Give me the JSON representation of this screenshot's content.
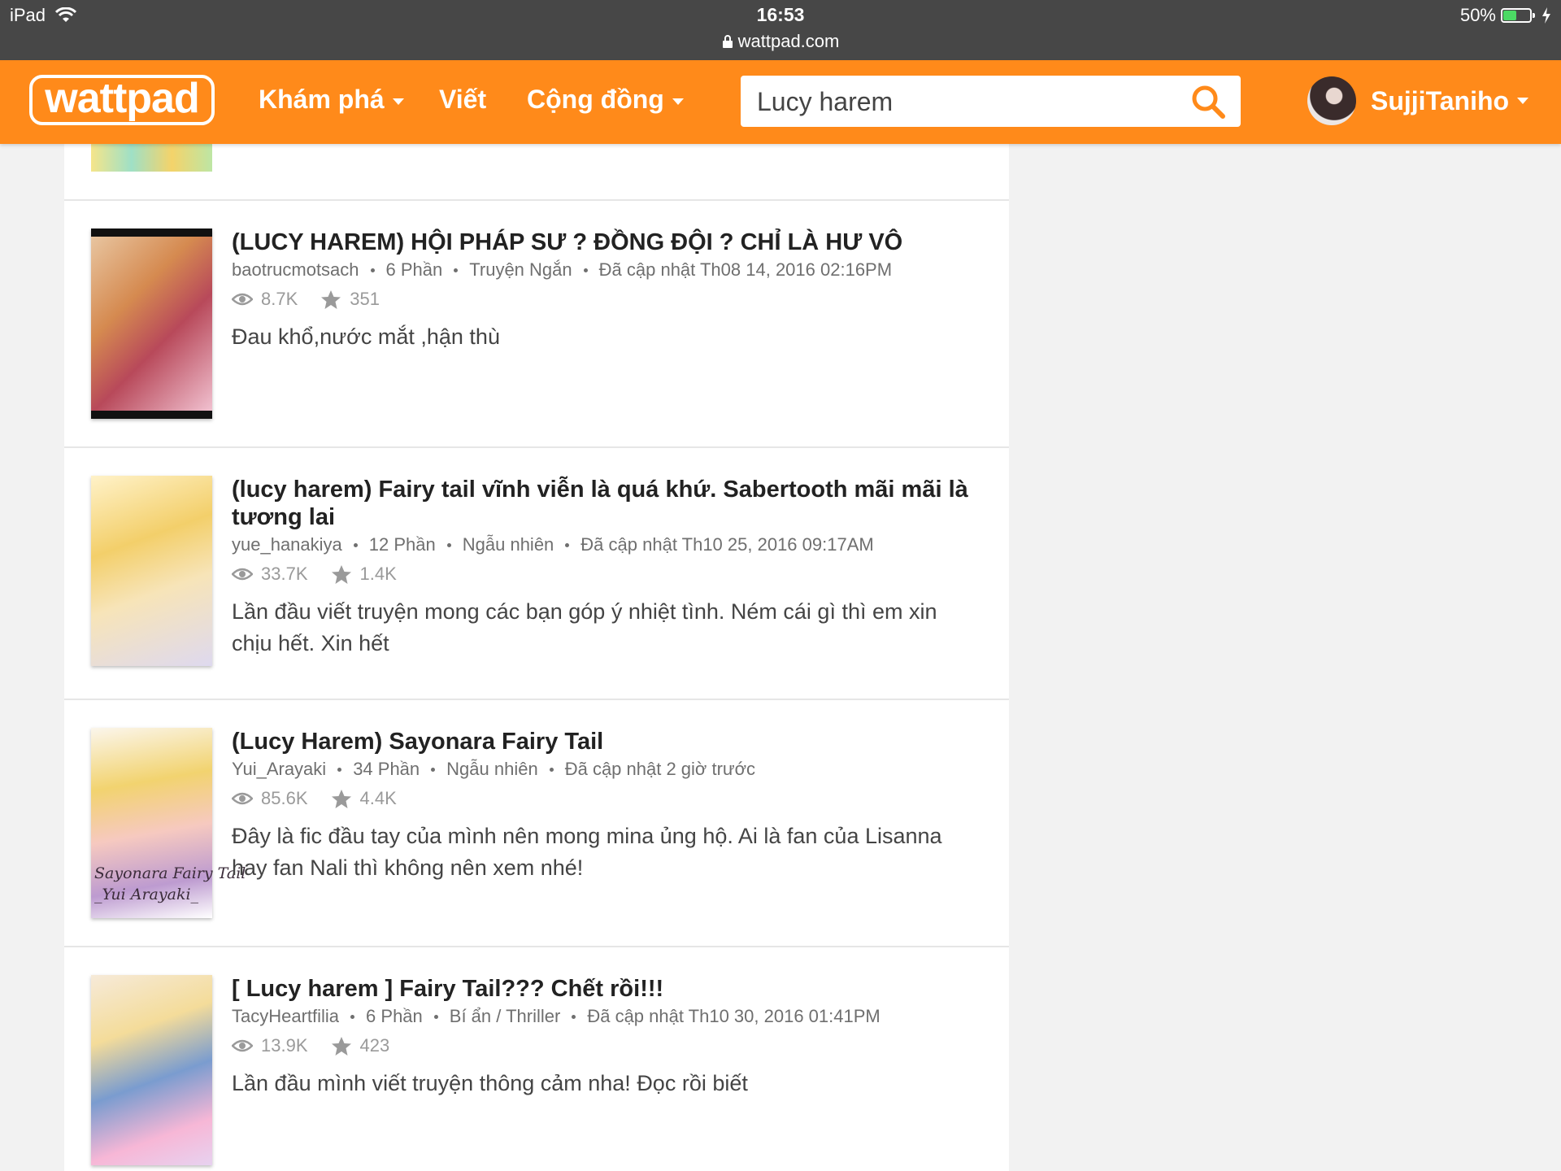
{
  "status": {
    "device": "iPad",
    "time": "16:53",
    "url": "wattpad.com",
    "battery": "50%",
    "battery_level": 0.5
  },
  "nav": {
    "logo": "wattpad",
    "discover": "Khám phá",
    "write": "Viết",
    "community": "Cộng đồng",
    "search_value": "Lucy harem",
    "username": "SujjiTaniho"
  },
  "stories": [
    {
      "title": "(LUCY HAREM) HỘI PHÁP SƯ ? ĐỒNG ĐỘI ? CHỈ LÀ HƯ VÔ",
      "author": "baotrucmotsach",
      "parts": "6 Phần",
      "genre": "Truyện Ngắn",
      "updated": "Đã cập nhật Th08 14, 2016 02:16PM",
      "reads": "8.7K",
      "votes": "351",
      "description": "Đau khổ,nước mắt ,hận thù"
    },
    {
      "title": "(lucy harem) Fairy tail vĩnh viễn là quá khứ. Sabertooth mãi mãi là tương lai",
      "author": "yue_hanakiya",
      "parts": "12 Phần",
      "genre": "Ngẫu nhiên",
      "updated": "Đã cập nhật Th10 25, 2016 09:17AM",
      "reads": "33.7K",
      "votes": "1.4K",
      "description": "Lần đầu viết truyện mong các bạn góp ý nhiệt tình. Ném cái gì thì em xin chịu hết. Xin hết"
    },
    {
      "title": "(Lucy Harem) Sayonara Fairy Tail",
      "author": "Yui_Arayaki",
      "parts": "34 Phần",
      "genre": "Ngẫu nhiên",
      "updated": "Đã cập nhật 2 giờ trước",
      "reads": "85.6K",
      "votes": "4.4K",
      "description": "Đây là fic đầu tay của mình nên mong mina ủng hộ. Ai là fan của Lisanna hay fan Nali thì không nên xem nhé!",
      "cover_text": "Sayonara Fairy Tail\n_Yui Arayaki_"
    },
    {
      "title": "[ Lucy harem ] Fairy Tail??? Chết rồi!!!",
      "author": "TacyHeartfilia",
      "parts": "6 Phần",
      "genre": "Bí ẩn / Thriller",
      "updated": "Đã cập nhật Th10 30, 2016 01:41PM",
      "reads": "13.9K",
      "votes": "423",
      "description": "Lần đầu mình viết truyện thông cảm nha! Đọc rồi biết"
    }
  ],
  "colors": {
    "brand": "#ff8a1a",
    "statusbar": "#474747"
  },
  "icons": [
    "wifi-icon",
    "lock-icon",
    "battery-icon",
    "chevron-down-icon",
    "search-icon",
    "eye-icon",
    "star-icon"
  ]
}
